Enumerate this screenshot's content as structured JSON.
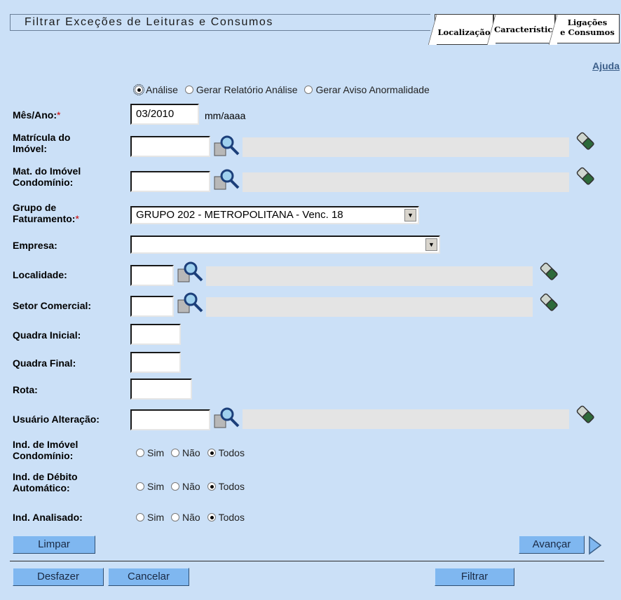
{
  "header": {
    "title": "Filtrar Exceções de Leituras e Consumos",
    "tabs": [
      {
        "label": "Localização"
      },
      {
        "label": "Característica"
      },
      {
        "line1": "Ligações",
        "line2": "e Consumos"
      }
    ]
  },
  "help_link": "Ajuda",
  "mode": {
    "options": [
      "Análise",
      "Gerar Relatório Análise",
      "Gerar Aviso Anormalidade"
    ],
    "selected": "Análise"
  },
  "fields": {
    "mes_ano": {
      "label": "Mês/Ano:",
      "required": "*",
      "value": "03/2010",
      "hint": "mm/aaaa"
    },
    "matricula": {
      "label_line1": "Matrícula do",
      "label_line2": "Imóvel:",
      "value": ""
    },
    "mat_condominio": {
      "label_line1": "Mat. do Imóvel",
      "label_line2": "Condomínio:",
      "value": ""
    },
    "grupo": {
      "label_line1": "Grupo de",
      "label_line2": "Faturamento:",
      "required": "*",
      "value": "GRUPO 202 - METROPOLITANA - Venc. 18"
    },
    "empresa": {
      "label": "Empresa:",
      "value": ""
    },
    "localidade": {
      "label": "Localidade:",
      "value": ""
    },
    "setor": {
      "label": "Setor Comercial:",
      "value": ""
    },
    "quadra_inicial": {
      "label": "Quadra Inicial:",
      "value": ""
    },
    "quadra_final": {
      "label": "Quadra Final:",
      "value": ""
    },
    "rota": {
      "label": "Rota:",
      "value": ""
    },
    "usuario": {
      "label": "Usuário Alteração:",
      "value": ""
    },
    "ind_condominio": {
      "label_line1": "Ind. de Imóvel",
      "label_line2": "Condomínio:",
      "selected": "Todos"
    },
    "ind_debito": {
      "label_line1": "Ind. de Débito",
      "label_line2": "Automático:",
      "selected": "Todos"
    },
    "ind_analisado": {
      "label": "Ind. Analisado:",
      "selected": "Todos"
    }
  },
  "tri_options": {
    "sim": "Sim",
    "nao": "Não",
    "todos": "Todos"
  },
  "buttons": {
    "limpar": "Limpar",
    "avancar": "Avançar",
    "desfazer": "Desfazer",
    "cancelar": "Cancelar",
    "filtrar": "Filtrar"
  },
  "icons": {
    "search": "magnifier-search-icon",
    "clear": "eraser-icon",
    "next": "arrow-right-icon"
  }
}
